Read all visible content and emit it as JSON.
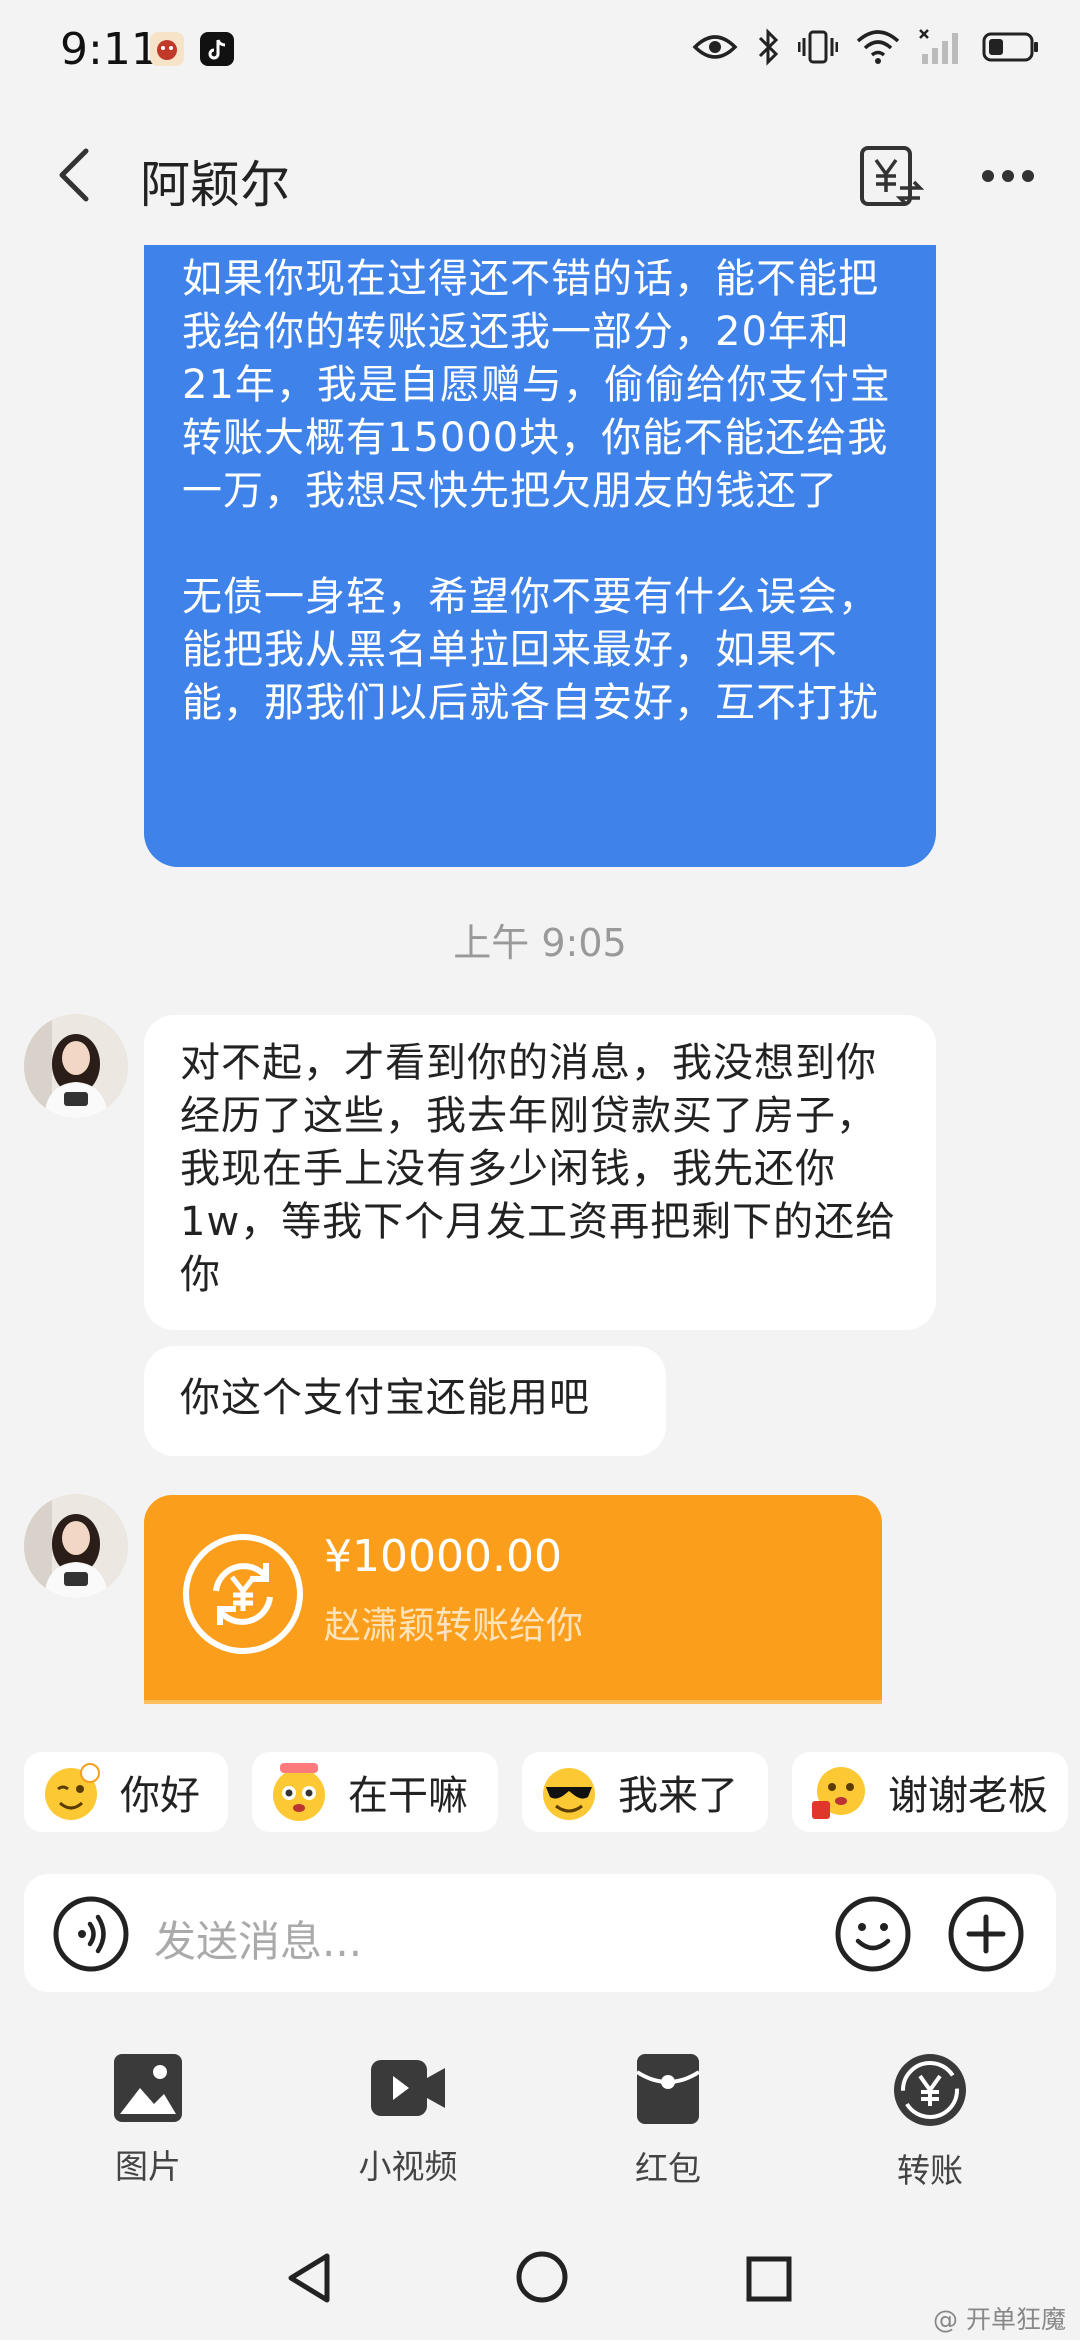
{
  "status_bar": {
    "time": "9:11"
  },
  "header": {
    "contact_name": "阿颖尔"
  },
  "messages": {
    "outgoing_para1": "如果你现在过得还不错的话，能不能把我给你的转账返还我一部分，20年和21年，我是自愿赠与，偷偷给你支付宝转账大概有15000块，你能不能还给我一万，我想尽快先把欠朋友的钱还了",
    "outgoing_para2": "无债一身轻，希望你不要有什么误会，能把我从黑名单拉回来最好，如果不能，那我们以后就各自安好，互不打扰",
    "timestamp": "上午 9:05",
    "incoming_1": "对不起，才看到你的消息，我没想到你经历了这些，我去年刚贷款买了房子，我现在手上没有多少闲钱，我先还你1w，等我下个月发工资再把剩下的还给你",
    "incoming_2": "你这个支付宝还能用吧"
  },
  "transfer": {
    "amount": "¥10000.00",
    "description": "赵潇颖转账给你"
  },
  "quick_replies": [
    "你好",
    "在干嘛",
    "我来了",
    "谢谢老板"
  ],
  "input": {
    "placeholder": "发送消息..."
  },
  "tools": [
    "图片",
    "小视频",
    "红包",
    "转账"
  ],
  "watermark": "@ 开单狂魔",
  "colors": {
    "outgoing_bubble": "#3f83ea",
    "transfer_card": "#fa9e1b",
    "background": "#f3f3f3"
  }
}
